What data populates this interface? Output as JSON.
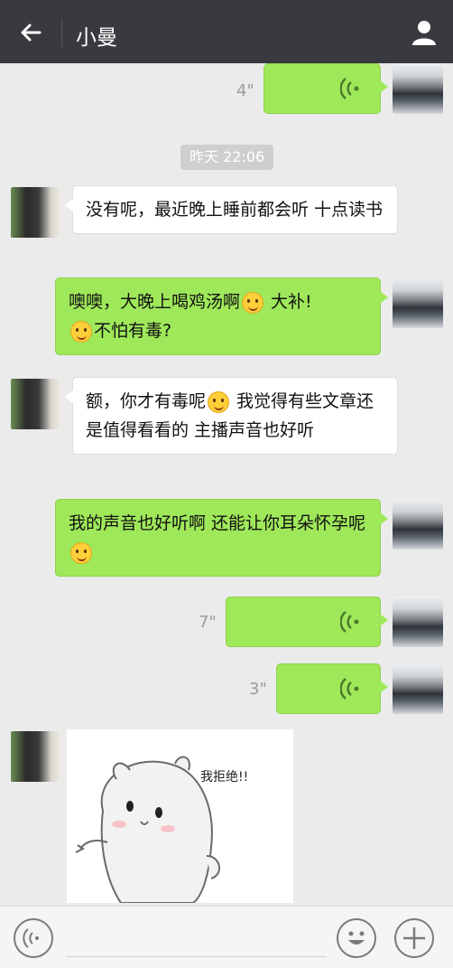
{
  "header": {
    "title": "小曼"
  },
  "timestamp": "昨天 22:06",
  "messages": {
    "v1": {
      "duration": "4\""
    },
    "m1": {
      "text": "没有呢，最近晚上睡前都会听 十点读书"
    },
    "m2": {
      "part1": "噢噢，大晚上喝鸡汤啊",
      "part2": " 大补!",
      "part3": "不怕有毒?"
    },
    "m3": {
      "part1": "额，你才有毒呢",
      "part2": " 我觉得有些文章还是值得看看的 主播声音也好听"
    },
    "m4": {
      "part1": "我的声音也好听啊 还能让你耳朵怀孕呢"
    },
    "v2": {
      "duration": "7\""
    },
    "v3": {
      "duration": "3\""
    },
    "sticker": {
      "text": "我拒绝!!"
    }
  },
  "icons": {
    "back": "back-arrow-icon",
    "profile": "person-icon",
    "voice_toggle": "voice-icon",
    "emoji": "emoji-icon",
    "plus": "plus-icon"
  }
}
